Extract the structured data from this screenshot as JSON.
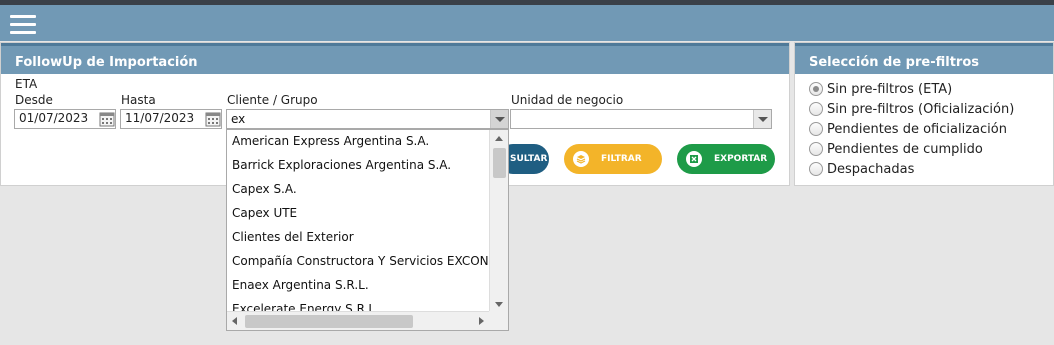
{
  "panels": {
    "main_title": "FollowUp de Importación",
    "prefilter_title": "Selección de pre-filtros"
  },
  "filters": {
    "eta_label": "ETA",
    "desde_label": "Desde",
    "desde_value": "01/07/2023",
    "hasta_label": "Hasta",
    "hasta_value": "11/07/2023",
    "cliente_label": "Cliente / Grupo",
    "cliente_value": "ex",
    "unidad_label": "Unidad de negocio",
    "unidad_value": ""
  },
  "buttons": {
    "consultar": "SULTAR",
    "filtrar": "FILTRAR",
    "exportar": "EXPORTAR"
  },
  "dropdown": {
    "items": [
      "American Express Argentina S.A.",
      "Barrick Exploraciones Argentina S.A.",
      "Capex S.A.",
      "Capex UTE",
      "Clientes del Exterior",
      "Compañía Constructora Y Servicios EXCON",
      "Enaex Argentina S.R.L.",
      "Excelerate Energy S.R.L."
    ]
  },
  "prefilters": {
    "options": [
      "Sin pre-filtros (ETA)",
      "Sin pre-filtros (Oficialización)",
      "Pendientes de oficialización",
      "Pendientes de cumplido",
      "Despachadas"
    ],
    "selected": "Sin pre-filtros (ETA)"
  },
  "colors": {
    "header_blue": "#7199b5",
    "consultar": "#1f5e82",
    "filtrar": "#f3b429",
    "exportar": "#1e9b48"
  },
  "icons": {
    "menu": "hamburger-icon",
    "calendar": "calendar-icon",
    "filter": "layers-icon",
    "export": "excel-icon"
  }
}
